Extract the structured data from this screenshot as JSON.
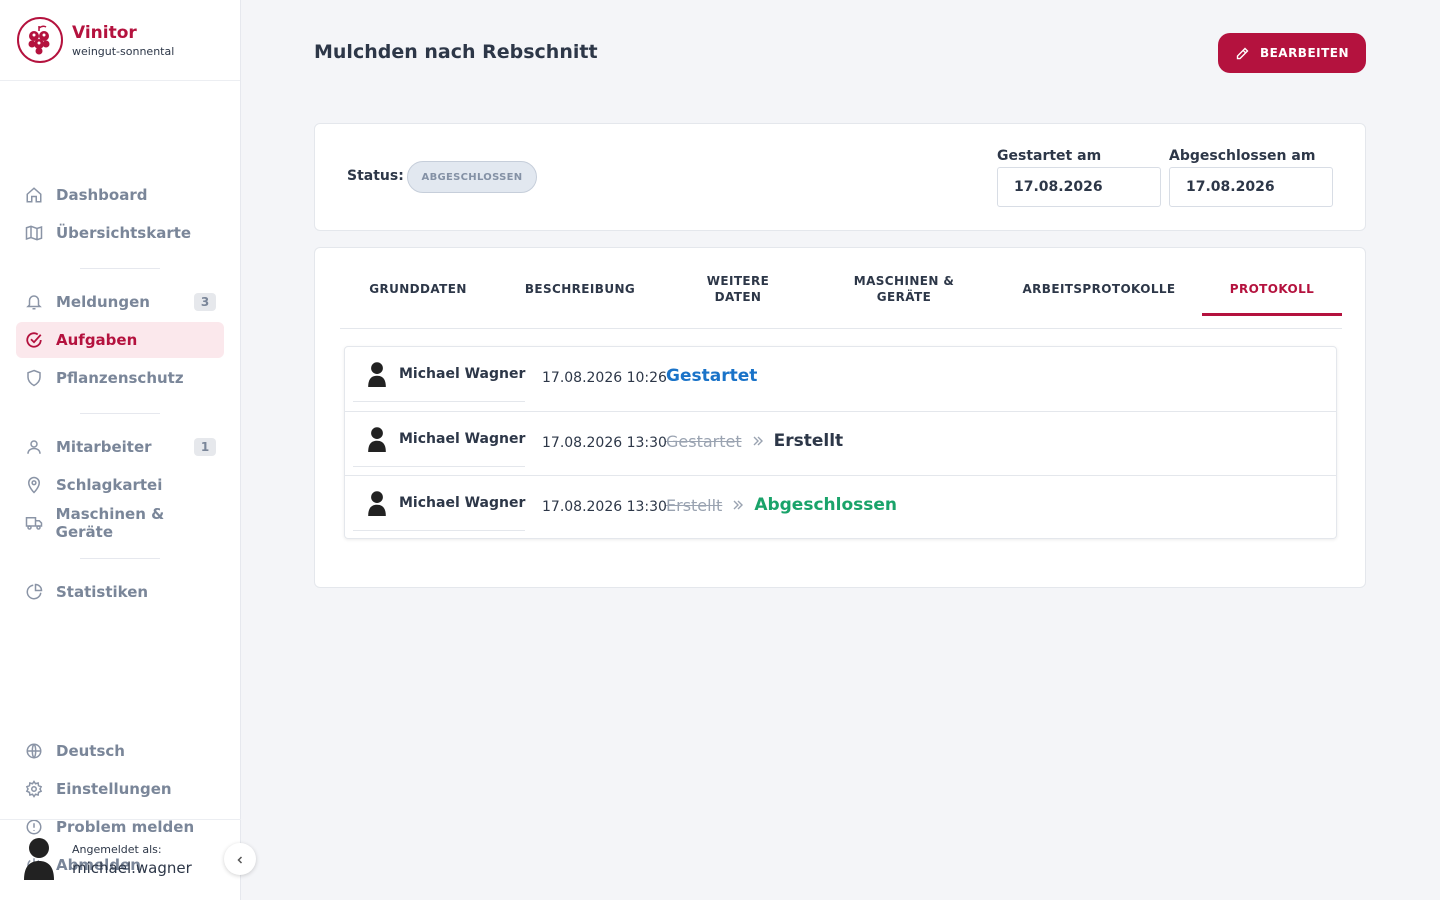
{
  "app": {
    "name": "Vinitor",
    "tenant": "weingut-sonnental",
    "brand_color": "#b4123e"
  },
  "sidebar": {
    "items": [
      {
        "label": "Dashboard",
        "icon": "home-icon"
      },
      {
        "label": "Übersichtskarte",
        "icon": "map-icon"
      },
      {
        "label": "Meldungen",
        "icon": "bell-icon",
        "badge": "3"
      },
      {
        "label": "Aufgaben",
        "icon": "check-circle-icon",
        "active": true
      },
      {
        "label": "Pflanzenschutz",
        "icon": "shield-icon"
      },
      {
        "label": "Mitarbeiter",
        "icon": "user-icon",
        "badge": "1"
      },
      {
        "label": "Schlagkartei",
        "icon": "map-pin-icon"
      },
      {
        "label": "Maschinen & Geräte",
        "icon": "truck-icon"
      },
      {
        "label": "Statistiken",
        "icon": "pie-chart-icon"
      }
    ],
    "footer_items": [
      {
        "label": "Deutsch",
        "icon": "globe-icon"
      },
      {
        "label": "Einstellungen",
        "icon": "gear-icon"
      },
      {
        "label": "Problem melden",
        "icon": "alert-circle-icon"
      },
      {
        "label": "Abmelden",
        "icon": "power-icon"
      }
    ],
    "user": {
      "label": "Angemeldet als:",
      "username": "michael.wagner"
    }
  },
  "page": {
    "title": "Mulchden nach Rebschnitt",
    "edit_button": "BEARBEITEN"
  },
  "status_card": {
    "status_label": "Status:",
    "status_value": "ABGESCHLOSSEN",
    "started_label": "Gestartet am",
    "started_value": "17.08.2026",
    "finished_label": "Abgeschlossen am",
    "finished_value": "17.08.2026"
  },
  "tabs": [
    {
      "label": "GRUNDDATEN"
    },
    {
      "label": "BESCHREIBUNG"
    },
    {
      "label": "WEITERE DATEN"
    },
    {
      "label": "MASCHINEN & GERÄTE"
    },
    {
      "label": "ARBEITSPROTOKOLLE"
    },
    {
      "label": "PROTOKOLL",
      "active": true
    }
  ],
  "log": [
    {
      "user": "Michael Wagner",
      "time": "17.08.2026 10:26",
      "old": "",
      "new": "Gestartet",
      "new_color": "#1a73c8"
    },
    {
      "user": "Michael Wagner",
      "time": "17.08.2026 13:30",
      "old": "Gestartet",
      "new": "Erstellt",
      "new_color": "#2d3748"
    },
    {
      "user": "Michael Wagner",
      "time": "17.08.2026 13:30",
      "old": "Erstellt",
      "new": "Abgeschlossen",
      "new_color": "#1aa36a"
    }
  ]
}
